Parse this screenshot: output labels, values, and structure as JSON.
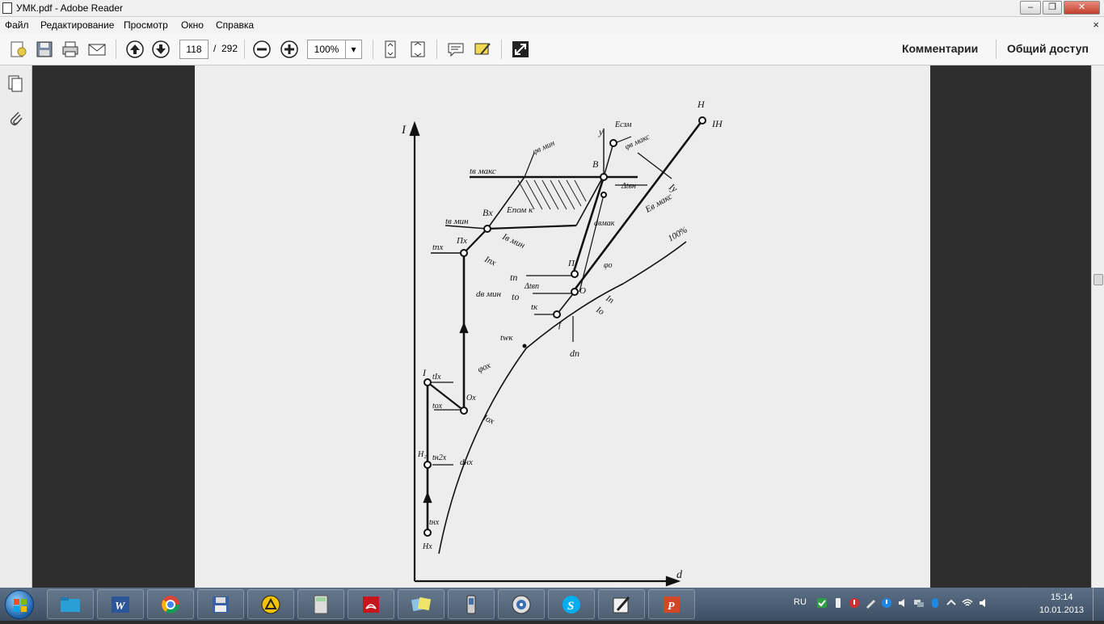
{
  "window": {
    "title": "УМК.pdf - Adobe Reader"
  },
  "menu": {
    "items": [
      "Файл",
      "Редактирование",
      "Просмотр",
      "Окно",
      "Справка"
    ],
    "close": "×"
  },
  "toolbar": {
    "page_current": "118",
    "page_sep": "/",
    "page_total": "292",
    "zoom": "100%",
    "comments": "Комментарии",
    "share": "Общий доступ"
  },
  "diagram": {
    "labels": {
      "I_axis": "I",
      "d_axis": "d",
      "H": "H",
      "I_H": "IН",
      "y": "y",
      "eps_ezm": "Eсзм",
      "phi_v_maks": "φв макс",
      "phi_v_min": "φв мин",
      "B": "B",
      "t_v_maks": "tв макс",
      "delta_t_bn": "Δtвн",
      "I_y": "Iу",
      "B_x": "Bх",
      "t_v_min": "tв мин",
      "eps_pom_k": "Eпом к",
      "d_b_max": "dвмак",
      "eps_v_maks": "Eв макс",
      "pct_100": "100%",
      "I_v_min": "Iв мин",
      "P_x": "Пх",
      "t_pk": "tпх",
      "I_pk": "Iпх",
      "P": "П",
      "t_n": "tп",
      "phi_o": "φо",
      "delta_t_bp": "Δtвп",
      "O": "О",
      "t_o": "tо",
      "I_n": "Iп",
      "I_o": "Iо",
      "t_k": "tк",
      "f": "f",
      "d_v_min": "dв мин",
      "d_n": "dп",
      "t_wk": "twк",
      "phi_ox": "φох",
      "I_lbl": "I",
      "t_ix": "tIх",
      "O_x": "Ох",
      "t_ox": "tох",
      "I_ox": "Iох",
      "H2": "Н₂",
      "t_n2x": "tн2х",
      "d_nx": "dнх",
      "t_nx": "tнх",
      "H_x": "Нх"
    }
  },
  "tray": {
    "lang": "RU",
    "time": "15:14",
    "date": "10.01.2013"
  }
}
